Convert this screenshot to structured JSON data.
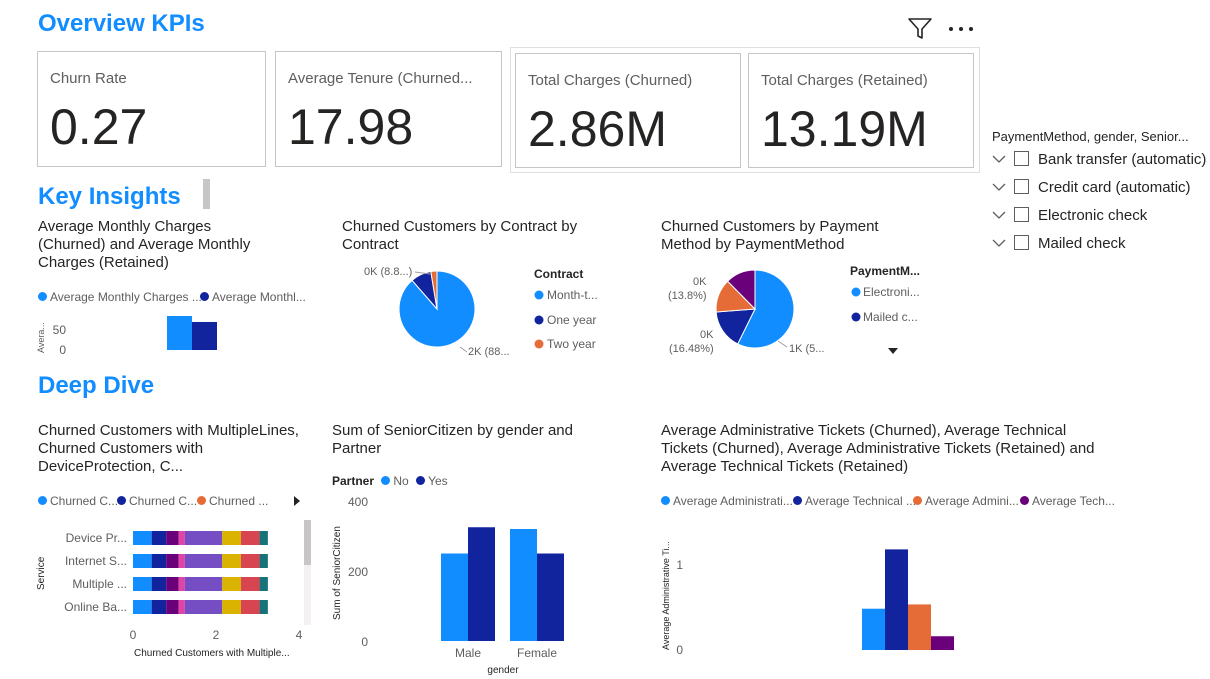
{
  "sections": {
    "overview": "Overview KPIs",
    "insights": "Key Insights",
    "deepdive": "Deep Dive"
  },
  "kpis": [
    {
      "label": "Churn Rate",
      "value": "0.27"
    },
    {
      "label": "Average Tenure (Churned...",
      "value": "17.98"
    },
    {
      "label": "Total Charges (Churned)",
      "value": "2.86M"
    },
    {
      "label": "Total Charges (Retained)",
      "value": "13.19M"
    }
  ],
  "slicer": {
    "title": "PaymentMethod, gender, Senior...",
    "items": [
      "Bank transfer (automatic)",
      "Credit card (automatic)",
      "Electronic check",
      "Mailed check"
    ]
  },
  "colors": {
    "blue": "#118DFF",
    "navy": "#12239E",
    "orange": "#E66C37",
    "purple": "#6B007B",
    "magenta": "#E044A7",
    "violet": "#744EC2",
    "yellow": "#D9B300",
    "red": "#D64550",
    "teal": "#197278"
  },
  "icons": [
    "filter-icon",
    "more-options-icon",
    "chevron-down-icon",
    "caret-right-icon",
    "caret-down-icon"
  ],
  "chart_data": [
    {
      "id": "avg-monthly",
      "type": "bar",
      "title": "Average Monthly Charges (Churned) and Average Monthly Charges (Retained)",
      "legend": [
        "Average Monthly Charges ...",
        "Average Monthl..."
      ],
      "ylabel": "Avera...",
      "yticks": [
        "50",
        "0"
      ],
      "ylim": [
        0,
        100
      ],
      "series": [
        {
          "name": "Average Monthly Charges ...",
          "values": [
            74
          ]
        },
        {
          "name": "Average Monthl...",
          "values": [
            61
          ]
        }
      ]
    },
    {
      "id": "contract-pie",
      "type": "pie",
      "title": "Churned Customers by Contract by Contract",
      "legend_title": "Contract",
      "categories": [
        "Month-t...",
        "One year",
        "Two year"
      ],
      "values": [
        88.6,
        8.8,
        2.6
      ],
      "labels": [
        "2K (88...",
        "0K (8.8...)"
      ]
    },
    {
      "id": "payment-pie",
      "type": "pie",
      "title": "Churned Customers by Payment Method by PaymentMethod",
      "legend_title": "PaymentM...",
      "categories": [
        "Electroni...",
        "Mailed c..."
      ],
      "values": [
        57.3,
        16.48,
        13.8,
        12.4
      ],
      "labels": [
        "1K (5...",
        "0K",
        "(16.48%)",
        "0K",
        "(13.8%)"
      ]
    },
    {
      "id": "multiple-lines",
      "type": "bar",
      "orientation": "horizontal-stacked",
      "title": "Churned Customers with MultipleLines, Churned Customers with DeviceProtection, C...",
      "legend": [
        "Churned C...",
        "Churned C...",
        "Churned ..."
      ],
      "categories": [
        "Device Pr...",
        "Internet S...",
        "Multiple ...",
        "Online Ba..."
      ],
      "xticks": [
        "0",
        "2",
        "4"
      ],
      "xlabel": "Churned Customers with Multiple...",
      "ylabel": "Service",
      "xlim": [
        0,
        4
      ],
      "segments": [
        0.45,
        0.35,
        0.3,
        0.15,
        0.9,
        0.45,
        0.45,
        0.2
      ]
    },
    {
      "id": "senior-citizen",
      "type": "bar",
      "title": "Sum of SeniorCitizen by gender and Partner",
      "legend_title": "Partner",
      "legend": [
        "No",
        "Yes"
      ],
      "categories": [
        "Male",
        "Female"
      ],
      "series": [
        {
          "name": "No",
          "values": [
            250,
            320
          ]
        },
        {
          "name": "Yes",
          "values": [
            325,
            250
          ]
        }
      ],
      "yticks": [
        "400",
        "200",
        "0"
      ],
      "ylim": [
        0,
        400
      ],
      "xlabel": "gender",
      "ylabel": "Sum of SeniorCitizen"
    },
    {
      "id": "admin-tickets",
      "type": "bar",
      "title": "Average Administrative Tickets (Churned), Average Technical Tickets (Churned), Average Administrative Tickets (Retained) and Average Technical Tickets (Retained)",
      "legend": [
        "Average Administrati...",
        "Average Technical ...",
        "Average Admini...",
        "Average Tech..."
      ],
      "ylabel": "Average Administrative Ti...",
      "yticks": [
        "1",
        "0"
      ],
      "ylim": [
        0,
        1.6
      ],
      "series": [
        {
          "name": "Average Administrati...",
          "values": [
            0.48
          ]
        },
        {
          "name": "Average Technical ...",
          "values": [
            1.17
          ]
        },
        {
          "name": "Average Admini...",
          "values": [
            0.53
          ]
        },
        {
          "name": "Average Tech...",
          "values": [
            0.16
          ]
        }
      ]
    }
  ]
}
